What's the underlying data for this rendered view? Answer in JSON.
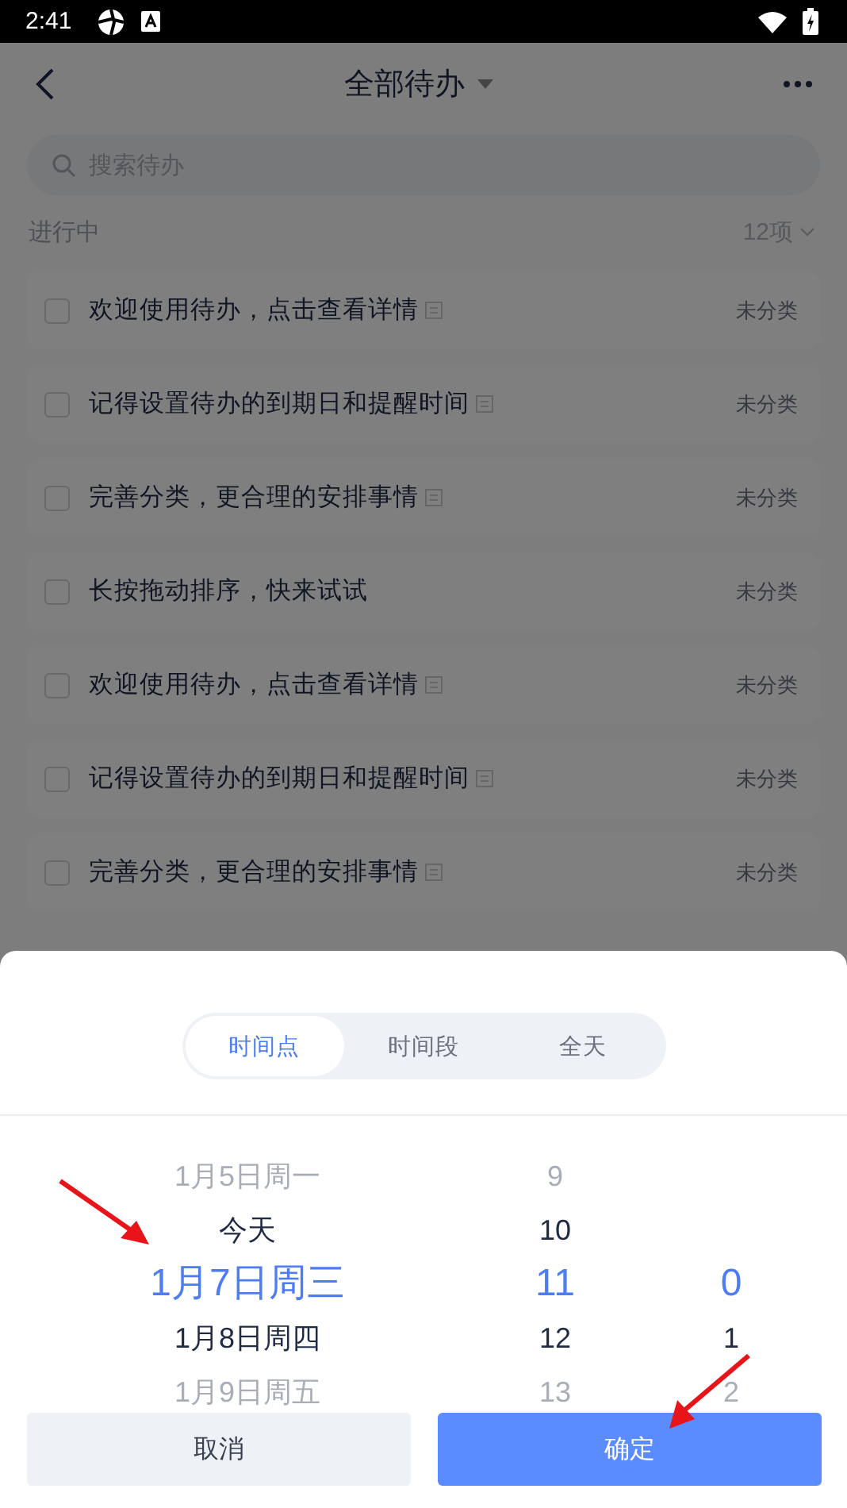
{
  "status_bar": {
    "time": "2:41"
  },
  "header": {
    "title": "全部待办"
  },
  "search": {
    "placeholder": "搜索待办"
  },
  "section": {
    "title": "进行中",
    "count": "12项"
  },
  "todos": [
    {
      "title": "欢迎使用待办，点击查看详情",
      "has_note": true,
      "checked": false,
      "category": "未分类"
    },
    {
      "title": "记得设置待办的到期日和提醒时间",
      "has_note": true,
      "checked": false,
      "category": "未分类"
    },
    {
      "title": "完善分类，更合理的安排事情",
      "has_note": true,
      "checked": false,
      "category": "未分类"
    },
    {
      "title": "长按拖动排序，快来试试",
      "has_note": false,
      "checked": false,
      "category": "未分类"
    },
    {
      "title": "欢迎使用待办，点击查看详情",
      "has_note": true,
      "checked": false,
      "category": "未分类"
    },
    {
      "title": "记得设置待办的到期日和提醒时间",
      "has_note": true,
      "checked": false,
      "category": "未分类"
    },
    {
      "title": "完善分类，更合理的安排事情",
      "has_note": true,
      "checked": false,
      "category": "未分类"
    }
  ],
  "sheet": {
    "tabs": [
      {
        "label": "时间点",
        "selected": true
      },
      {
        "label": "时间段",
        "selected": false
      },
      {
        "label": "全天",
        "selected": false
      }
    ],
    "columns": [
      {
        "items": [
          {
            "label": "1月5日周一",
            "selected": false
          },
          {
            "label": "今天",
            "selected": false
          },
          {
            "label": "1月7日周三",
            "selected": true
          },
          {
            "label": "1月8日周四",
            "selected": false
          },
          {
            "label": "1月9日周五",
            "selected": false
          }
        ]
      },
      {
        "items": [
          {
            "label": "9",
            "selected": false
          },
          {
            "label": "10",
            "selected": false
          },
          {
            "label": "11",
            "selected": true
          },
          {
            "label": "12",
            "selected": false
          },
          {
            "label": "13",
            "selected": false
          }
        ]
      },
      {
        "items": [
          {
            "label": "0",
            "selected": true
          },
          {
            "label": "1",
            "selected": false
          },
          {
            "label": "2",
            "selected": false
          }
        ]
      }
    ],
    "buttons": [
      {
        "label": "取消",
        "kind": "secondary"
      },
      {
        "label": "确定",
        "kind": "primary"
      }
    ]
  }
}
